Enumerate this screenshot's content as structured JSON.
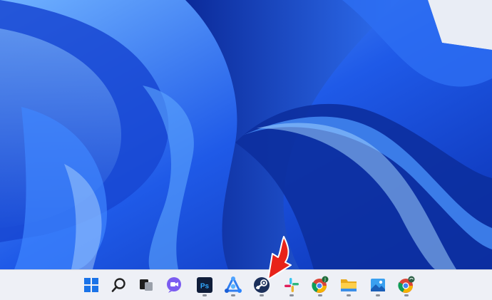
{
  "desktop": {
    "wallpaper": "windows-11-bloom",
    "colors": {
      "deep": "#0a2fb0",
      "mid": "#1f5ae8",
      "light": "#5fa7ff",
      "pale": "#b9dcff",
      "bg": "#e9edf5"
    }
  },
  "taskbar": {
    "background": "#eef0f6",
    "items": [
      {
        "name": "start-button",
        "icon": "windows-logo-icon",
        "running": false
      },
      {
        "name": "search-button",
        "icon": "search-icon",
        "running": false
      },
      {
        "name": "task-view-button",
        "icon": "task-view-icon",
        "running": false
      },
      {
        "name": "chat-button",
        "icon": "chat-icon",
        "running": false
      },
      {
        "name": "photoshop-button",
        "icon": "photoshop-icon",
        "label": "Ps",
        "running": true
      },
      {
        "name": "app-button",
        "icon": "app-icon",
        "running": true
      },
      {
        "name": "steam-button",
        "icon": "steam-icon",
        "running": true
      },
      {
        "name": "slack-button",
        "icon": "slack-icon",
        "running": true
      },
      {
        "name": "chrome-button-1",
        "icon": "chrome-icon",
        "running": true
      },
      {
        "name": "file-explorer-button",
        "icon": "folder-icon",
        "running": true
      },
      {
        "name": "photos-button",
        "icon": "photos-icon",
        "running": true
      },
      {
        "name": "chrome-button-2",
        "icon": "chrome-icon",
        "running": true
      }
    ]
  },
  "annotation": {
    "icon": "red-arrow-icon",
    "color": "#e8231a",
    "target": "steam-button"
  }
}
